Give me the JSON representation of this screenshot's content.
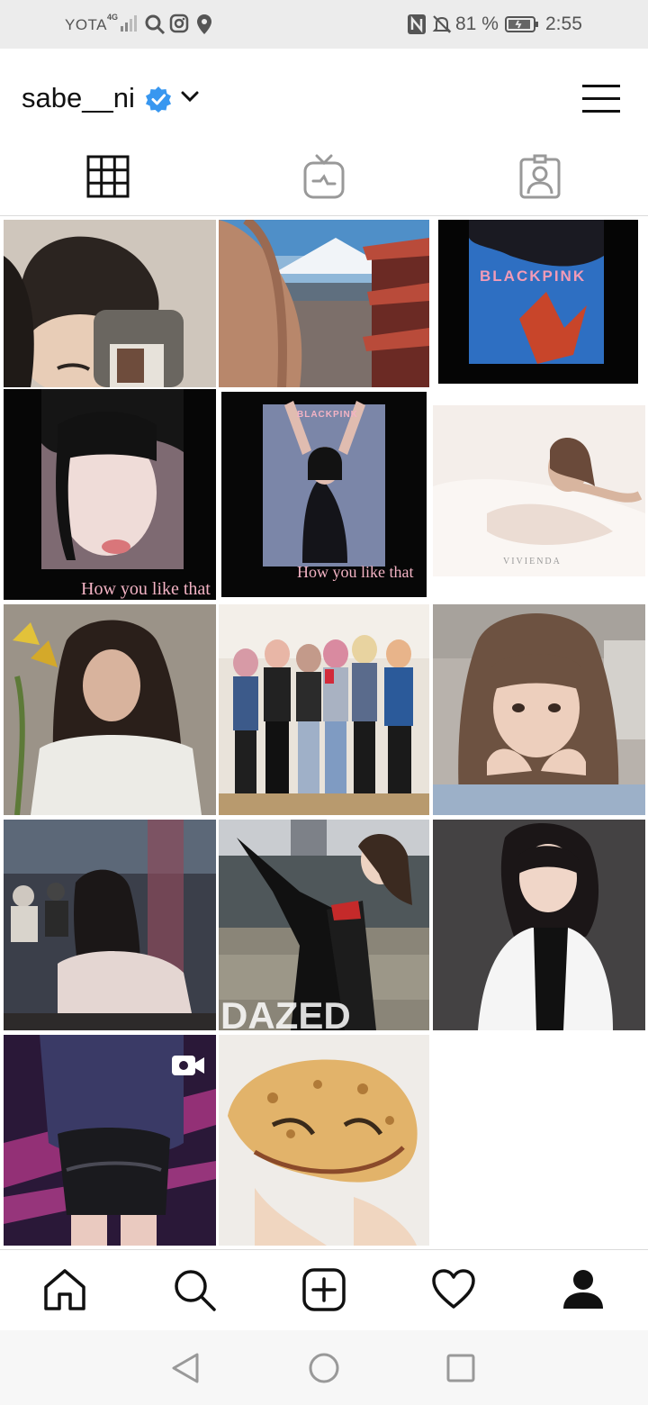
{
  "status_bar": {
    "carrier": "YOTA",
    "network": "4G",
    "signal": "4G",
    "battery_percent": "81 %",
    "time": "2:55",
    "icons": [
      "search-icon",
      "instagram-icon",
      "location-icon",
      "nfc-icon",
      "mute-icon",
      "battery-icon"
    ]
  },
  "header": {
    "username": "sabe__ni",
    "verified": true,
    "icons": [
      "verified-badge-icon",
      "chevron-down-icon",
      "menu-icon"
    ]
  },
  "tabs": [
    {
      "name": "posts-grid",
      "icon": "grid-icon",
      "active": true
    },
    {
      "name": "igtv",
      "icon": "tv-icon",
      "active": false
    },
    {
      "name": "tagged",
      "icon": "tagged-person-icon",
      "active": false
    }
  ],
  "posts": [
    {
      "kind": "photo",
      "caption_text": ""
    },
    {
      "kind": "photo",
      "caption_text": ""
    },
    {
      "kind": "photo",
      "caption_text": "BLACKPINK"
    },
    {
      "kind": "photo",
      "caption_text": "How you like that"
    },
    {
      "kind": "photo",
      "caption_text": "How you like that",
      "top_text": "BLACKPINK"
    },
    {
      "kind": "photo",
      "caption_text": "VIVIENDA"
    },
    {
      "kind": "photo",
      "caption_text": ""
    },
    {
      "kind": "photo",
      "caption_text": ""
    },
    {
      "kind": "photo",
      "caption_text": ""
    },
    {
      "kind": "photo",
      "caption_text": ""
    },
    {
      "kind": "photo",
      "caption_text": "DAZED"
    },
    {
      "kind": "photo",
      "caption_text": ""
    },
    {
      "kind": "video",
      "caption_text": ""
    },
    {
      "kind": "photo",
      "caption_text": ""
    }
  ],
  "bottom_nav": [
    {
      "name": "home",
      "icon": "home-icon"
    },
    {
      "name": "search",
      "icon": "search-icon"
    },
    {
      "name": "new-post",
      "icon": "add-post-icon"
    },
    {
      "name": "activity",
      "icon": "heart-icon"
    },
    {
      "name": "profile",
      "icon": "profile-icon",
      "active": true
    }
  ],
  "system_nav": [
    "back-icon",
    "home-circle-icon",
    "recents-icon"
  ],
  "colors": {
    "verified_blue": "#3897f0",
    "status_bar_bg": "#ececec",
    "icon_dark": "#111111",
    "icon_gray": "#555555"
  }
}
